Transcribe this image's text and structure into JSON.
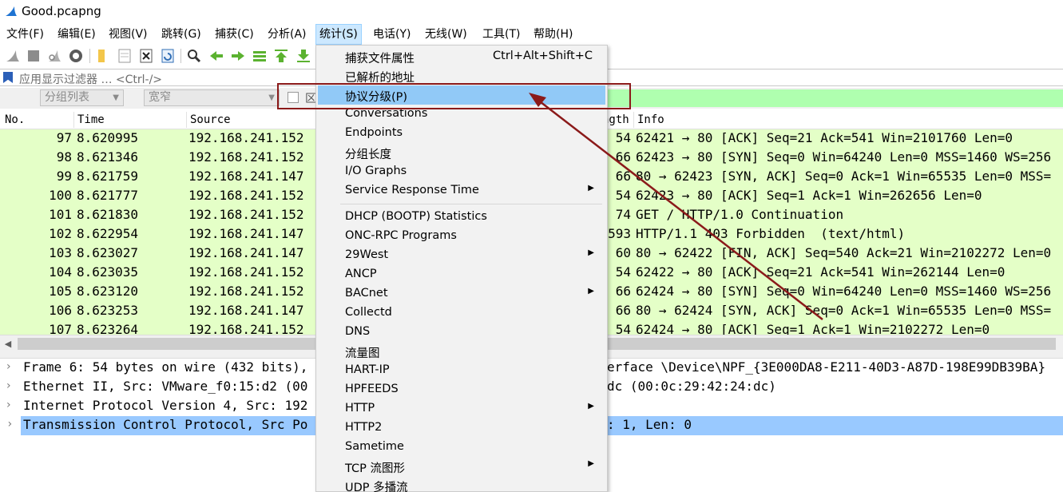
{
  "window": {
    "title": "Good.pcapng"
  },
  "menubar": [
    {
      "label": "文件(F)",
      "active": false
    },
    {
      "label": "编辑(E)",
      "active": false
    },
    {
      "label": "视图(V)",
      "active": false
    },
    {
      "label": "跳转(G)",
      "active": false
    },
    {
      "label": "捕获(C)",
      "active": false
    },
    {
      "label": "分析(A)",
      "active": false
    },
    {
      "label": "统计(S)",
      "active": true
    },
    {
      "label": "电话(Y)",
      "active": false
    },
    {
      "label": "无线(W)",
      "active": false
    },
    {
      "label": "工具(T)",
      "active": false
    },
    {
      "label": "帮助(H)",
      "active": false
    }
  ],
  "filter": {
    "placeholder": "应用显示过滤器 … <Ctrl-/>"
  },
  "secondary_bar": {
    "group_list": "分组列表",
    "width": "宽窄",
    "checkbox_label": "区"
  },
  "columns": [
    "No.",
    "Time",
    "Source",
    "ngth",
    "Info"
  ],
  "packets": [
    {
      "no": "97",
      "time": "8.620995",
      "src": "192.168.241.152",
      "len": "54",
      "info": "62421 → 80 [ACK] Seq=21 Ack=541 Win=2101760 Len=0"
    },
    {
      "no": "98",
      "time": "8.621346",
      "src": "192.168.241.152",
      "len": "66",
      "info": "62423 → 80 [SYN] Seq=0 Win=64240 Len=0 MSS=1460 WS=256"
    },
    {
      "no": "99",
      "time": "8.621759",
      "src": "192.168.241.147",
      "len": "66",
      "info": "80 → 62423 [SYN, ACK] Seq=0 Ack=1 Win=65535 Len=0 MSS="
    },
    {
      "no": "100",
      "time": "8.621777",
      "src": "192.168.241.152",
      "len": "54",
      "info": "62423 → 80 [ACK] Seq=1 Ack=1 Win=262656 Len=0"
    },
    {
      "no": "101",
      "time": "8.621830",
      "src": "192.168.241.152",
      "len": "74",
      "info": "GET / HTTP/1.0 Continuation"
    },
    {
      "no": "102",
      "time": "8.622954",
      "src": "192.168.241.147",
      "len": "593",
      "info": "HTTP/1.1 403 Forbidden  (text/html)"
    },
    {
      "no": "103",
      "time": "8.623027",
      "src": "192.168.241.147",
      "len": "60",
      "info": "80 → 62422 [FIN, ACK] Seq=540 Ack=21 Win=2102272 Len=0"
    },
    {
      "no": "104",
      "time": "8.623035",
      "src": "192.168.241.152",
      "len": "54",
      "info": "62422 → 80 [ACK] Seq=21 Ack=541 Win=262144 Len=0"
    },
    {
      "no": "105",
      "time": "8.623120",
      "src": "192.168.241.152",
      "len": "66",
      "info": "62424 → 80 [SYN] Seq=0 Win=64240 Len=0 MSS=1460 WS=256"
    },
    {
      "no": "106",
      "time": "8.623253",
      "src": "192.168.241.147",
      "len": "66",
      "info": "80 → 62424 [SYN, ACK] Seq=0 Ack=1 Win=65535 Len=0 MSS="
    },
    {
      "no": "107",
      "time": "8.623264",
      "src": "192.168.241.152",
      "len": "54",
      "info": "62424 → 80 [ACK] Seq=1 Ack=1 Win=2102272 Len=0"
    }
  ],
  "details": [
    {
      "text": "Frame 6: 54 bytes on wire (432 bits),",
      "tail": "erface \\Device\\NPF_{3E000DA8-E211-40D3-A87D-198E99DB39BA}",
      "selected": false
    },
    {
      "text": "Ethernet II, Src: VMware_f0:15:d2 (00",
      "tail": "dc (00:0c:29:42:24:dc)",
      "selected": false
    },
    {
      "text": "Internet Protocol Version 4, Src: 192",
      "tail": "",
      "selected": false
    },
    {
      "text": "Transmission Control Protocol, Src Po",
      "tail": ": 1, Len: 0",
      "selected": true
    }
  ],
  "stats_menu": [
    {
      "label": "捕获文件属性",
      "shortcut": "Ctrl+Alt+Shift+C",
      "submenu": false,
      "highlighted": false
    },
    {
      "label": "已解析的地址",
      "shortcut": "",
      "submenu": false,
      "highlighted": false
    },
    {
      "label": "协议分级(P)",
      "shortcut": "",
      "submenu": false,
      "highlighted": true
    },
    {
      "label": "Conversations",
      "shortcut": "",
      "submenu": false,
      "highlighted": false
    },
    {
      "label": "Endpoints",
      "shortcut": "",
      "submenu": false,
      "highlighted": false
    },
    {
      "label": "分组长度",
      "shortcut": "",
      "submenu": false,
      "highlighted": false
    },
    {
      "label": "I/O Graphs",
      "shortcut": "",
      "submenu": false,
      "highlighted": false
    },
    {
      "label": "Service Response Time",
      "shortcut": "",
      "submenu": true,
      "highlighted": false
    },
    {
      "label": "DHCP (BOOTP) Statistics",
      "shortcut": "",
      "submenu": false,
      "highlighted": false
    },
    {
      "label": "ONC-RPC Programs",
      "shortcut": "",
      "submenu": false,
      "highlighted": false
    },
    {
      "label": "29West",
      "shortcut": "",
      "submenu": true,
      "highlighted": false
    },
    {
      "label": "ANCP",
      "shortcut": "",
      "submenu": false,
      "highlighted": false
    },
    {
      "label": "BACnet",
      "shortcut": "",
      "submenu": true,
      "highlighted": false
    },
    {
      "label": "Collectd",
      "shortcut": "",
      "submenu": false,
      "highlighted": false
    },
    {
      "label": "DNS",
      "shortcut": "",
      "submenu": false,
      "highlighted": false
    },
    {
      "label": "流量图",
      "shortcut": "",
      "submenu": false,
      "highlighted": false
    },
    {
      "label": "HART-IP",
      "shortcut": "",
      "submenu": false,
      "highlighted": false
    },
    {
      "label": "HPFEEDS",
      "shortcut": "",
      "submenu": false,
      "highlighted": false
    },
    {
      "label": "HTTP",
      "shortcut": "",
      "submenu": true,
      "highlighted": false
    },
    {
      "label": "HTTP2",
      "shortcut": "",
      "submenu": false,
      "highlighted": false
    },
    {
      "label": "Sametime",
      "shortcut": "",
      "submenu": false,
      "highlighted": false
    },
    {
      "label": "TCP 流图形",
      "shortcut": "",
      "submenu": true,
      "highlighted": false
    },
    {
      "label": "UDP 多播流",
      "shortcut": "",
      "submenu": false,
      "highlighted": false
    }
  ],
  "colors": {
    "packet_row_bg": "#e4ffc7",
    "menu_highlight": "#91c9f7",
    "selected_detail": "#99c9ff",
    "annotation_red": "#8b1a1a",
    "filter_ok_green": "#afffaf"
  },
  "toolbar_icons": [
    "shark-fin-start-icon",
    "stop-icon",
    "restart-icon",
    "options-gear-icon",
    "open-folder-icon",
    "file-icon",
    "close-file-icon",
    "reload-icon",
    "find-icon",
    "back-arrow-icon",
    "forward-arrow-icon",
    "go-to-packet-icon",
    "first-packet-icon",
    "last-packet-icon"
  ]
}
